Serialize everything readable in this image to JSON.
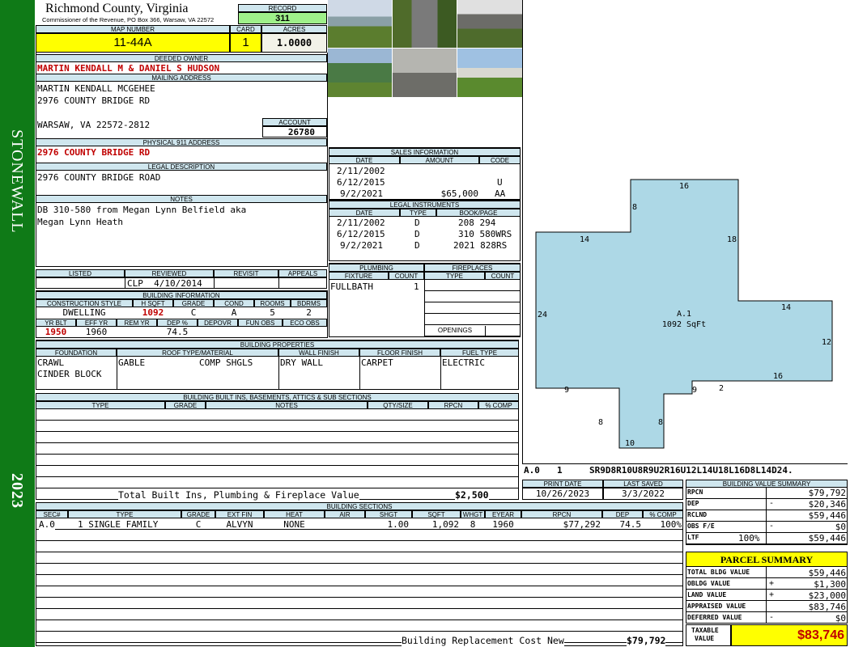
{
  "sidebar": {
    "district": "STONEWALL",
    "year": "2023",
    "color": "#0f7a17"
  },
  "header": {
    "county": "Richmond County, Virginia",
    "commissioner": "Commissioner of the Revenue, PO Box 366, Warsaw, VA 22572",
    "record_label": "RECORD",
    "record": "311",
    "map_label": "MAP NUMBER",
    "map": "11-44A",
    "card_label": "CARD",
    "card": "1",
    "acres_label": "ACRES",
    "acres": "1.0000"
  },
  "owner": {
    "deeded_label": "DEEDED OWNER",
    "deeded": "MARTIN KENDALL M & DANIEL S HUDSON",
    "mailing_label": "MAILING ADDRESS",
    "mail1": "MARTIN KENDALL MCGEHEE",
    "mail2": "2976 COUNTY BRIDGE RD",
    "mail3": "WARSAW, VA 22572-2812",
    "account_label": "ACCOUNT",
    "account": "26780",
    "physical_label": "PHYSICAL 911 ADDRESS",
    "physical": "2976 COUNTY BRIDGE RD",
    "legal_label": "LEGAL DESCRIPTION",
    "legal": "2976 COUNTY BRIDGE ROAD",
    "notes_label": "NOTES",
    "notes1": "DB 310-580 from Megan Lynn Belfield aka",
    "notes2": "Megan Lynn Heath"
  },
  "review": {
    "listed_label": "LISTED",
    "reviewed_label": "REVIEWED",
    "revisit_label": "REVISIT",
    "appeals_label": "APPEALS",
    "reviewed": "CLP  4/10/2014"
  },
  "building_info": {
    "title": "BUILDING INFORMATION",
    "h_style": "CONSTRUCTION STYLE",
    "h_hsqft": "H SQFT",
    "h_grade": "GRADE",
    "h_cond": "COND",
    "h_rooms": "ROOMS",
    "h_bdrms": "BDRMS",
    "style": "DWELLING",
    "hsqft": "1092",
    "grade": "C",
    "cond": "A",
    "rooms": "5",
    "bdrms": "2",
    "h_yrblt": "YR BLT",
    "h_effyr": "EFF YR",
    "h_remyr": "REM YR",
    "h_dep": "DEP %",
    "h_depovr": "DEPOVR",
    "h_funobs": "FUN OBS",
    "h_ecoobs": "ECO OBS",
    "yrblt": "1950",
    "effyr": "1960",
    "dep": "74.5"
  },
  "properties": {
    "title": "BUILDING PROPERTIES",
    "h_found": "FOUNDATION",
    "h_roof": "ROOF TYPE/MATERIAL",
    "h_wall": "WALL FINISH",
    "h_floor": "FLOOR FINISH",
    "h_fuel": "FUEL TYPE",
    "found1": "CRAWL",
    "found2": "CINDER BLOCK",
    "roof_type": "GABLE",
    "roof_mat": "COMP SHGLS",
    "wall": "DRY WALL",
    "floor": "CARPET",
    "fuel": "ELECTRIC"
  },
  "builtins": {
    "title": "BUILDING BUILT INS, BASEMENTS, ATTICS & SUB SECTIONS",
    "h_type": "TYPE",
    "h_grade": "GRADE",
    "h_notes": "NOTES",
    "h_qty": "QTY/SIZE",
    "h_rpcn": "RPCN",
    "h_comp": "% COMP",
    "total_label": "Total Built Ins, Plumbing & Fireplace Value",
    "total": "$2,500"
  },
  "sales": {
    "title": "SALES INFORMATION",
    "h_date": "DATE",
    "h_amount": "AMOUNT",
    "h_code": "CODE",
    "rows": [
      {
        "date": "2/11/2002",
        "amount": "",
        "code": ""
      },
      {
        "date": "6/12/2015",
        "amount": "",
        "code": "U"
      },
      {
        "date": "9/2/2021",
        "amount": "$65,000",
        "code": "AA"
      }
    ]
  },
  "legal_instruments": {
    "title": "LEGAL INSTRUMENTS",
    "h_date": "DATE",
    "h_type": "TYPE",
    "h_book": "BOOK/PAGE",
    "rows": [
      {
        "date": "2/11/2002",
        "type": "D",
        "book": "208 294"
      },
      {
        "date": "6/12/2015",
        "type": "D",
        "book": "310 580WRS"
      },
      {
        "date": "9/2/2021",
        "type": "D",
        "book": "2021 828RS"
      }
    ]
  },
  "plumbing": {
    "title": "PLUMBING",
    "h_fixture": "FIXTURE",
    "h_count": "COUNT",
    "fixture": "FULLBATH",
    "count": "1"
  },
  "fireplaces": {
    "title": "FIREPLACES",
    "h_type": "TYPE",
    "h_count": "COUNT",
    "openings": "OPENINGS"
  },
  "sketch": {
    "label": "A.1",
    "sqft": "1092 SqFt",
    "dims": [
      "16",
      "8",
      "14",
      "18",
      "24",
      "14",
      "12",
      "16",
      "9",
      "9",
      "2",
      "8",
      "8",
      "10"
    ],
    "vector_id": "A.0",
    "vector_no": "1",
    "vector": "SR9D8R10U8R9U2R16U12L14U18L16D8L14D24.",
    "fill": "#add8e6"
  },
  "print": {
    "print_label": "PRINT DATE",
    "saved_label": "LAST SAVED",
    "print_date": "10/26/2023",
    "last_saved": "3/3/2022"
  },
  "sections": {
    "title": "BUILDING SECTIONS",
    "headers": [
      "SEC#",
      "TYPE",
      "GRADE",
      "EXT FIN",
      "HEAT",
      "AIR",
      "SHGT",
      "SQFT",
      "WHGT",
      "EYEAR",
      "RPCN",
      "DEP",
      "% COMP"
    ],
    "row": {
      "sec": "A.0",
      "type": "1 SINGLE FAMILY",
      "grade": "C",
      "extfin": "ALVYN",
      "heat": "NONE",
      "air": "",
      "shgt": "1.00",
      "sqft": "1,092",
      "whgt": "8",
      "eyear": "1960",
      "rpcn": "$77,292",
      "dep": "74.5",
      "comp": "100%"
    },
    "brcn_label": "Building Replacement Cost New",
    "brcn": "$79,792"
  },
  "value_summary": {
    "title": "BUILDING VALUE SUMMARY",
    "rpcn_label": "RPCN",
    "rpcn": "$79,792",
    "dep_label": "DEP",
    "dep_sign": "-",
    "dep": "$20,346",
    "rclnd_label": "RCLND",
    "rclnd": "$59,446",
    "obs_label": "OBS F/E",
    "obs_sign": "-",
    "obs": "$0",
    "ltf_label": "LTF",
    "ltf_pct": "100%",
    "ltf": "$59,446"
  },
  "parcel": {
    "title": "PARCEL SUMMARY",
    "tb_label": "TOTAL BLDG VALUE",
    "tb": "$59,446",
    "ob_label": "OBLDG VALUE",
    "ob_sign": "+",
    "ob": "$1,300",
    "land_label": "LAND VALUE",
    "land_sign": "+",
    "land": "$23,000",
    "appr_label": "APPRAISED VALUE",
    "appr": "$83,746",
    "def_label": "DEFERRED VALUE",
    "def_sign": "-",
    "def": "$0",
    "tax_label1": "TAXABLE",
    "tax_label2": "VALUE",
    "taxable": "$83,746"
  }
}
